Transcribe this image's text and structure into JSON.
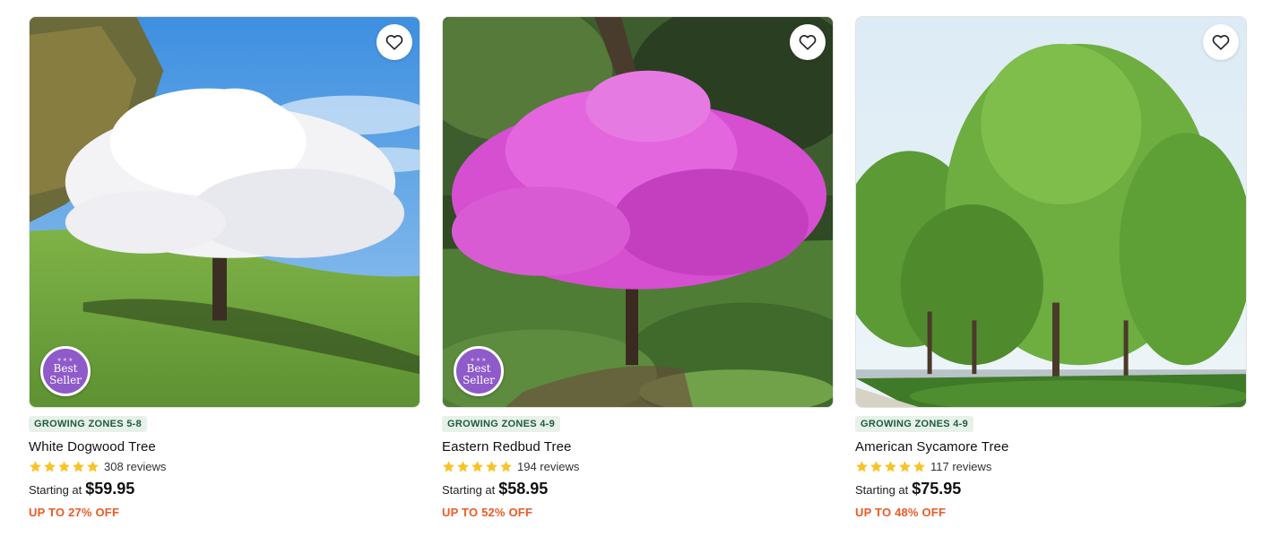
{
  "products": [
    {
      "name": "White Dogwood Tree",
      "zones": "GROWING ZONES 5-8",
      "reviews": "308 reviews",
      "starting_label": "Starting at",
      "price": "$59.95",
      "discount": "UP TO 27% OFF",
      "badge_line1": "Best",
      "badge_line2": "Seller",
      "rating": 5
    },
    {
      "name": "Eastern Redbud Tree",
      "zones": "GROWING ZONES 4-9",
      "reviews": "194 reviews",
      "starting_label": "Starting at",
      "price": "$58.95",
      "discount": "UP TO 52% OFF",
      "badge_line1": "Best",
      "badge_line2": "Seller",
      "rating": 5
    },
    {
      "name": "American Sycamore Tree",
      "zones": "GROWING ZONES 4-9",
      "reviews": "117 reviews",
      "starting_label": "Starting at",
      "price": "$75.95",
      "discount": "UP TO 48% OFF",
      "rating": 5
    }
  ],
  "icons": {
    "wishlist": "heart-outline-icon",
    "star": "star-icon"
  },
  "colors": {
    "zones_bg": "#e7f1ea",
    "zones_text": "#205b3c",
    "discount": "#ec5a26",
    "star": "#f7c325",
    "badge": "#8e5bc9"
  }
}
